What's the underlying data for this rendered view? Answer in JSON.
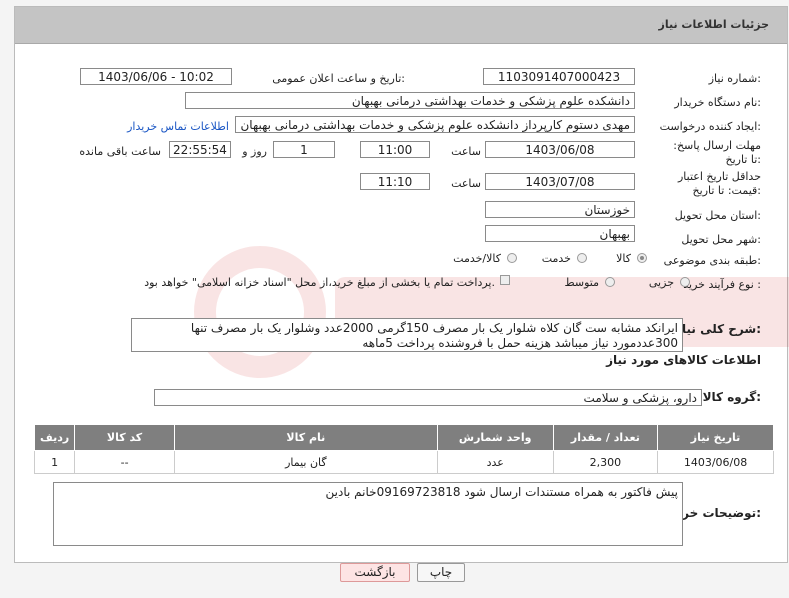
{
  "header": {
    "title": "جزئیات اطلاعات نیاز"
  },
  "fields": {
    "need_number_label": "شماره نیاز:",
    "need_number": "1103091407000423",
    "announce_label": "تاریخ و ساعت اعلان عمومی:",
    "announce_value": "1403/06/06 - 10:02",
    "buyer_org_label": "نام دستگاه خریدار:",
    "buyer_org": "دانشکده علوم پزشکی و خدمات بهداشتی  درمانی بهبهان",
    "creator_label": "ایجاد کننده درخواست:",
    "creator": "مهدی دستوم کارپرداز دانشکده علوم پزشکی و خدمات بهداشتی  درمانی بهبهان",
    "contact_link": "اطلاعات تماس خریدار",
    "deadline_label": "مهلت ارسال پاسخ: تا تاریخ:",
    "deadline_date": "1403/06/08",
    "time_label": "ساعت",
    "deadline_time": "11:00",
    "days_value": "1",
    "days_label": "روز و",
    "remaining_time": "22:55:54",
    "remaining_label": "ساعت باقی مانده",
    "validity_label": "حداقل تاریخ اعتبار قیمت: تا تاریخ:",
    "validity_date": "1403/07/08",
    "validity_time": "11:10",
    "province_label": "استان محل تحویل:",
    "province": "خوزستان",
    "city_label": "شهر محل تحویل:",
    "city": "بهبهان",
    "category_label": "طبقه بندی موضوعی:",
    "category_options": [
      "کالا",
      "خدمت",
      "کالا/خدمت"
    ],
    "process_label": "نوع فرآیند خرید :",
    "process_options": [
      "جزیی",
      "متوسط"
    ],
    "payment_note": "پرداخت تمام یا بخشی از مبلغ خرید،از محل \"اسناد خزانه اسلامی\" خواهد بود.",
    "description_label": "شرح کلی نیاز:",
    "description": "ایرانکد مشابه ست گان کلاه شلوار یک بار مصرف 150گرمی  2000عدد  وشلوار یک بار مصرف تنها 300عددمورد نیاز میباشد هزینه حمل با فروشنده پرداخت 5ماهه",
    "goods_info_title": "اطلاعات کالاهای مورد نیاز",
    "goods_group_label": "گروه کالا:",
    "goods_group": "دارو، پزشکی و سلامت",
    "buyer_notes_label": "توضیحات خریدار:",
    "buyer_notes": "پیش فاکتور به همراه مستندات ارسال شود 09169723818خانم بادین"
  },
  "table": {
    "headers": [
      "ردیف",
      "کد کالا",
      "نام کالا",
      "واحد شمارش",
      "تعداد / مقدار",
      "تاریخ نیاز"
    ],
    "rows": [
      [
        "1",
        "--",
        "گان بیمار",
        "عدد",
        "2,300",
        "1403/06/08"
      ]
    ]
  },
  "buttons": {
    "print": "چاپ",
    "back": "بازگشت"
  },
  "colors": {
    "header_bg": "#c4c4c4",
    "table_header_bg": "#7f7f7f",
    "link": "#1a56c4",
    "back_btn_bg": "#fde4e4"
  }
}
